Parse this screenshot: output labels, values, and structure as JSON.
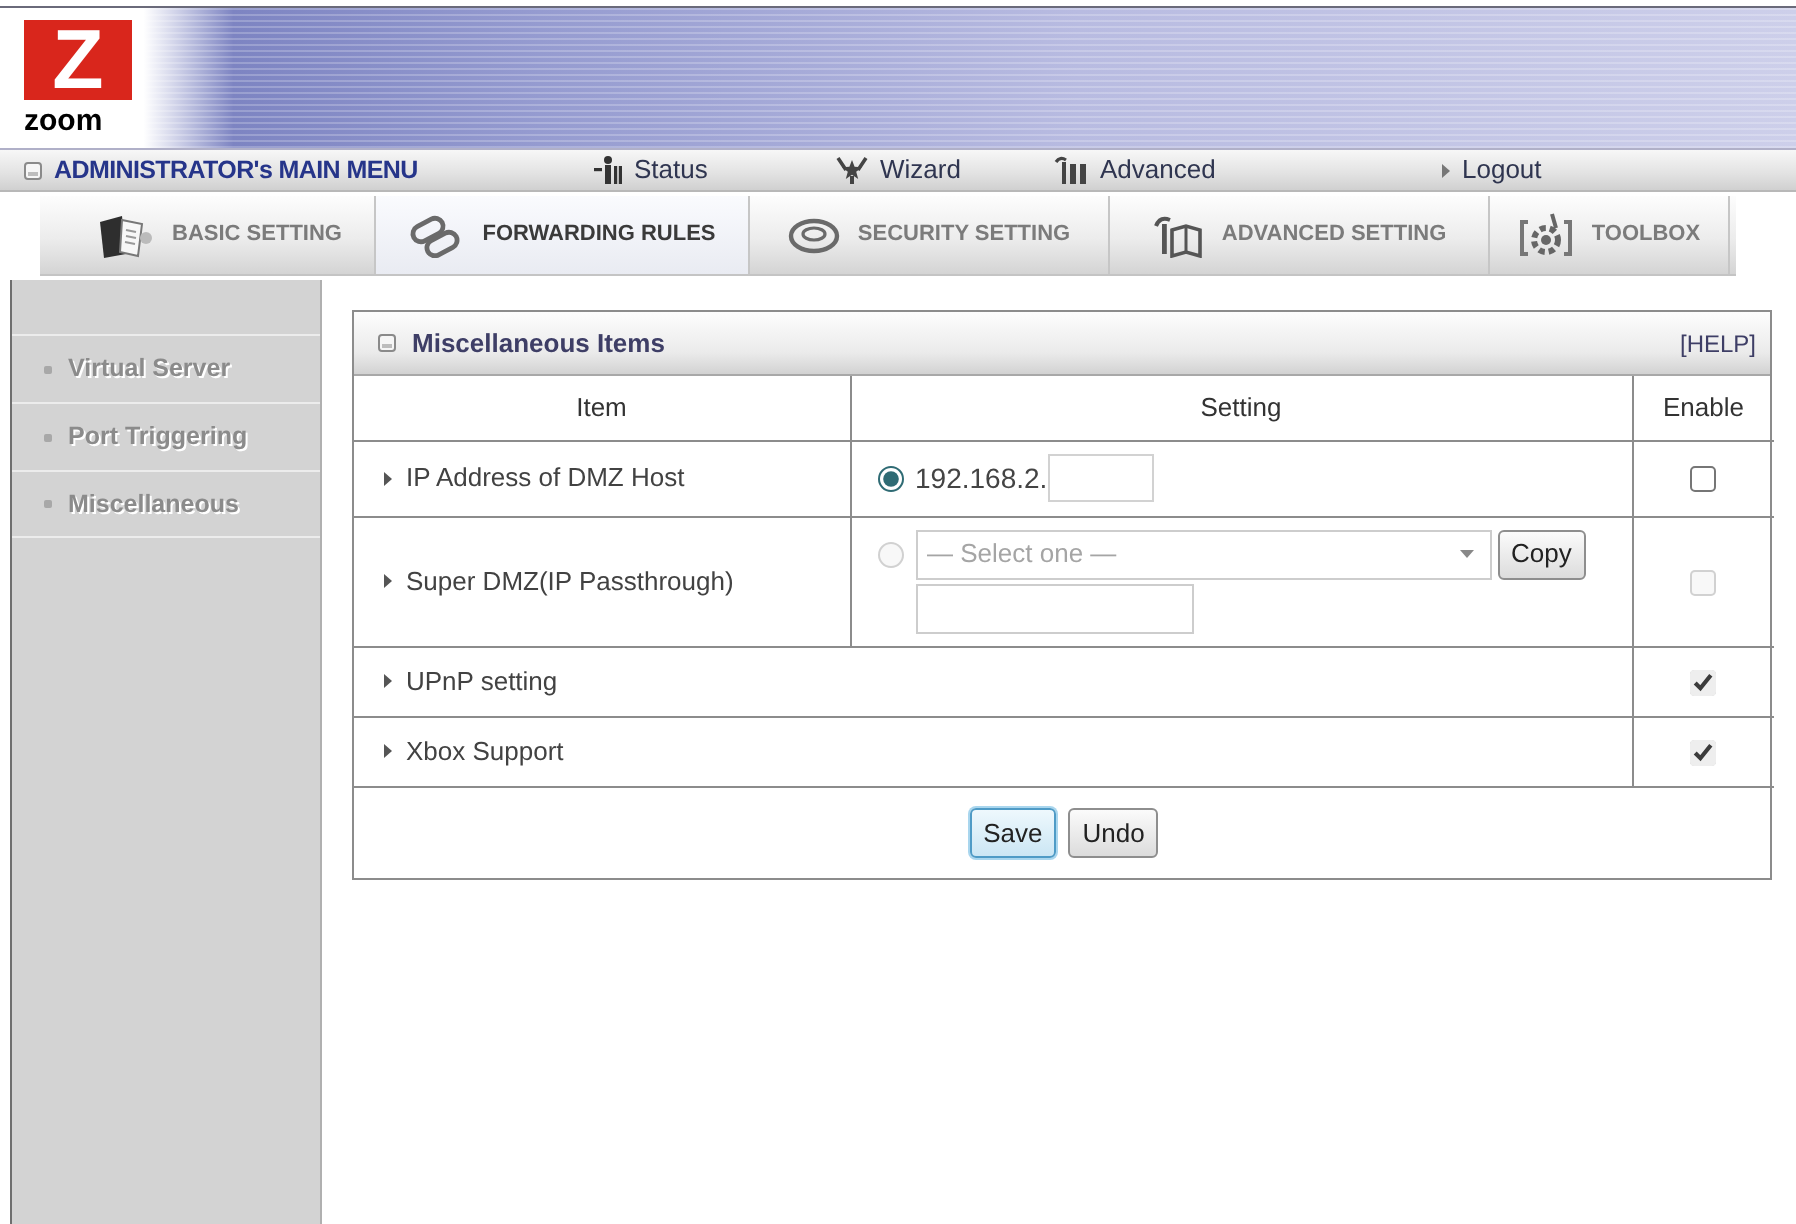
{
  "header": {
    "logo": {
      "mark": "Z",
      "text": "zoom"
    }
  },
  "main_menu": {
    "title": "ADMINISTRATOR's MAIN MENU",
    "links": [
      {
        "kind": "status",
        "label": "Status"
      },
      {
        "kind": "wizard",
        "label": "Wizard"
      },
      {
        "kind": "advanced",
        "label": "Advanced"
      },
      {
        "kind": "logout",
        "label": "Logout"
      }
    ]
  },
  "tabs": [
    {
      "kind": "basic",
      "label": "BASIC SETTING",
      "selected": false
    },
    {
      "kind": "forwarding",
      "label": "FORWARDING RULES",
      "selected": true
    },
    {
      "kind": "security",
      "label": "SECURITY SETTING",
      "selected": false
    },
    {
      "kind": "advanced",
      "label": "ADVANCED SETTING",
      "selected": false
    },
    {
      "kind": "toolbox",
      "label": "TOOLBOX",
      "selected": false
    }
  ],
  "sidebar": {
    "items": [
      {
        "label": "Virtual Server"
      },
      {
        "label": "Port Triggering"
      },
      {
        "label": "Miscellaneous"
      }
    ]
  },
  "panel": {
    "title": "Miscellaneous Items",
    "help": "[HELP]",
    "table": {
      "columns": [
        "Item",
        "Setting",
        "Enable"
      ],
      "rows": [
        {
          "kind": "dmz_host",
          "label": "IP Address of DMZ Host",
          "radio": {
            "selected": true
          },
          "ip_prefix": "192.168.2.",
          "enabled": false,
          "disabled": false
        },
        {
          "kind": "super_dmz",
          "label": "Super DMZ(IP Passthrough)",
          "radio": {
            "selected": false
          },
          "dropdown": {
            "value": "— Select one —"
          },
          "copy_button": "Copy",
          "enabled": false,
          "disabled": true
        },
        {
          "kind": "plain",
          "label": "UPnP setting",
          "enabled": true,
          "disabled": false
        },
        {
          "kind": "plain",
          "label": "Xbox Support",
          "enabled": true,
          "disabled": false
        }
      ]
    },
    "buttons": [
      {
        "label": "Save",
        "focused": true
      },
      {
        "label": "Undo",
        "focused": false
      }
    ]
  }
}
